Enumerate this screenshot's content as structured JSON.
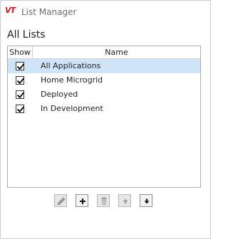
{
  "window": {
    "logo_text": "VT",
    "title": "List Manager"
  },
  "heading": "All Lists",
  "table": {
    "columns": [
      "Show",
      "Name"
    ],
    "rows": [
      {
        "checked": true,
        "name": "All Applications",
        "selected": true
      },
      {
        "checked": true,
        "name": "Home Microgrid",
        "selected": false
      },
      {
        "checked": true,
        "name": "Deployed",
        "selected": false
      },
      {
        "checked": true,
        "name": "In Development",
        "selected": false
      }
    ]
  },
  "toolbar": {
    "buttons": [
      {
        "icon": "pencil-icon",
        "enabled": false
      },
      {
        "icon": "plus-icon",
        "enabled": true
      },
      {
        "icon": "trash-icon",
        "enabled": false
      },
      {
        "icon": "arrow-up-icon",
        "enabled": false
      },
      {
        "icon": "arrow-down-icon",
        "enabled": true
      }
    ]
  },
  "colors": {
    "selected_row": "#cfe5f7",
    "logo_red": "#c8161d"
  }
}
